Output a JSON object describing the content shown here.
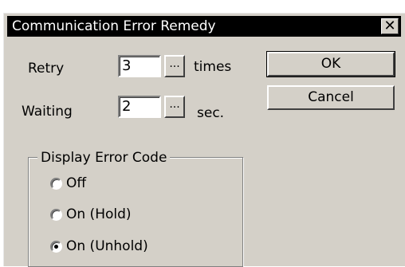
{
  "window": {
    "title": "Communication Error Remedy",
    "close_glyph": "✕",
    "close_icon": "close-icon"
  },
  "retry": {
    "label": "Retry",
    "value": "3",
    "browse_label": "...",
    "unit": "times"
  },
  "waiting": {
    "label": "Waiting",
    "value": "2",
    "browse_label": "...",
    "unit": "sec."
  },
  "buttons": {
    "ok": "OK",
    "cancel": "Cancel"
  },
  "display_error_code": {
    "legend": "Display Error Code",
    "options": [
      {
        "label": "Off",
        "checked": false
      },
      {
        "label": "On (Hold)",
        "checked": false
      },
      {
        "label": "On (Unhold)",
        "checked": true
      }
    ]
  },
  "colors": {
    "face": "#d4d0c8",
    "titlebar": "#000000",
    "title_text": "#ffffff"
  }
}
